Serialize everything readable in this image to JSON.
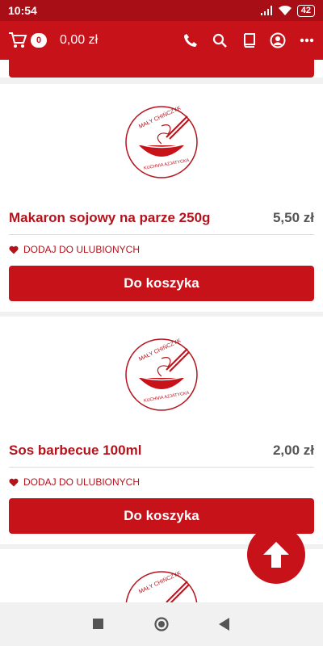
{
  "status": {
    "time": "10:54",
    "battery": "42"
  },
  "header": {
    "cart_count": "0",
    "cart_total": "0,00 zł"
  },
  "products": [
    {
      "name": "Makaron sojowy na parze 250g",
      "price": "5,50 zł",
      "favorite_label": "DODAJ DO ULUBIONYCH",
      "button_label": "Do koszyka"
    },
    {
      "name": "Sos barbecue 100ml",
      "price": "2,00 zł",
      "favorite_label": "DODAJ DO ULUBIONYCH",
      "button_label": "Do koszyka"
    }
  ],
  "logo_text": {
    "top": "MAŁY CHIŃCZYK",
    "bottom": "KUCHNIA AZJATYCKA"
  },
  "colors": {
    "brand": "#c8121a",
    "status_bar": "#a80e16"
  },
  "icons": [
    "cart-icon",
    "phone-icon",
    "search-icon",
    "book-icon",
    "user-icon",
    "more-icon",
    "heart-icon",
    "arrow-up-icon"
  ]
}
